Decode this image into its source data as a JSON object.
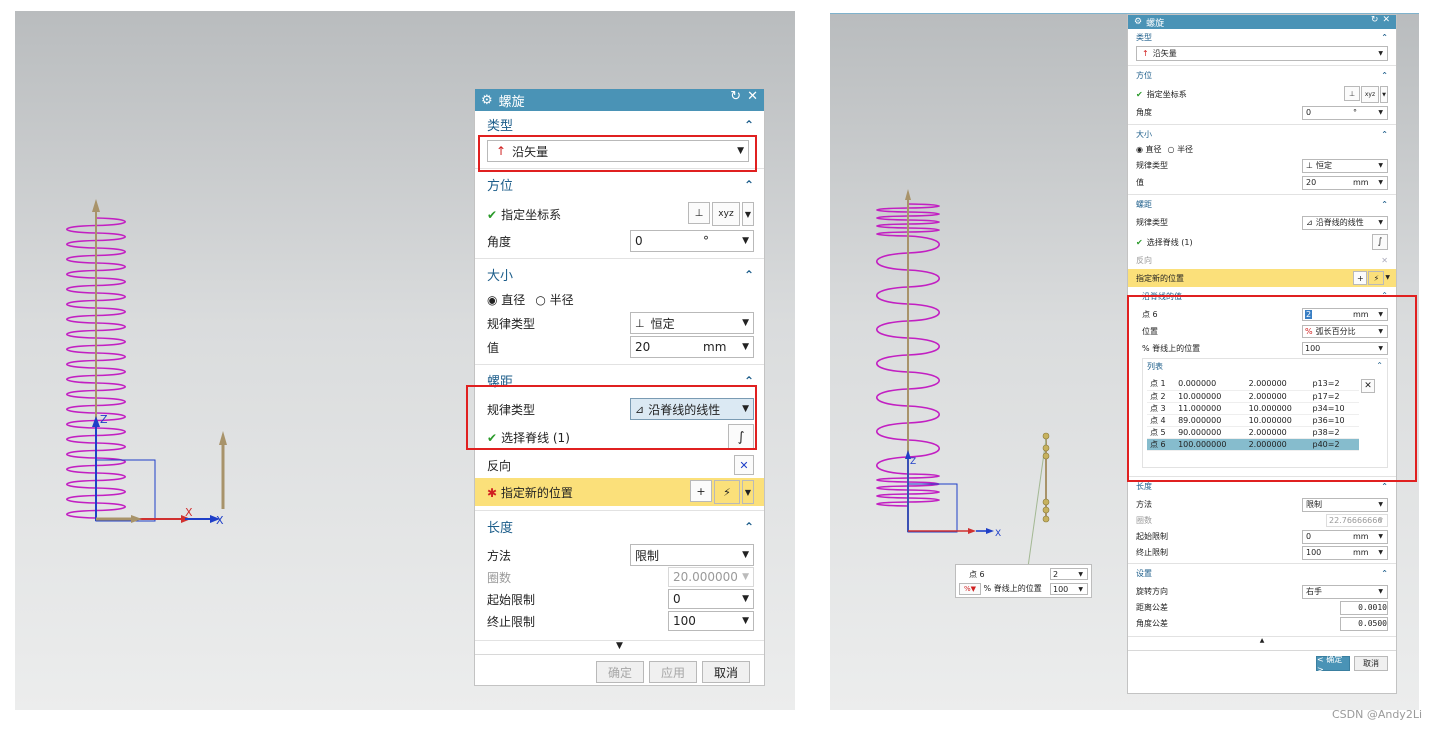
{
  "left": {
    "dialog": {
      "title": "螺旋",
      "type_section": {
        "header": "类型",
        "type_value": "沿矢量"
      },
      "orient_section": {
        "header": "方位",
        "csys_label": "指定坐标系",
        "angle_label": "角度",
        "angle_value": "0",
        "angle_unit": "°"
      },
      "size_section": {
        "header": "大小",
        "radio_diameter": "直径",
        "radio_radius": "半径",
        "law_label": "规律类型",
        "law_value": "恒定",
        "value_label": "值",
        "value": "20",
        "unit": "mm"
      },
      "pitch_section": {
        "header": "螺距",
        "law_label": "规律类型",
        "law_value": "沿脊线的线性",
        "spine_label": "选择脊线 (1)",
        "reverse_label": "反向",
        "newpos_label": "指定新的位置"
      },
      "length_section": {
        "header": "长度",
        "method_label": "方法",
        "method_value": "限制",
        "turns_label": "圈数",
        "turns_value": "20.000000",
        "start_label": "起始限制",
        "start_value": "0",
        "end_label": "终止限制",
        "end_value": "100"
      },
      "buttons": {
        "ok": "确定",
        "apply": "应用",
        "cancel": "取消"
      }
    },
    "axis": {
      "y": "Y",
      "z": "Z",
      "x": "X"
    }
  },
  "right": {
    "dialog": {
      "title": "螺旋",
      "type_section": {
        "header": "类型",
        "type_value": "沿矢量"
      },
      "orient_section": {
        "header": "方位",
        "csys_label": "指定坐标系",
        "angle_label": "角度",
        "angle_value": "0",
        "angle_unit": "°"
      },
      "size_section": {
        "header": "大小",
        "radio_diameter": "直径",
        "radio_radius": "半径",
        "law_label": "规律类型",
        "law_value": "恒定",
        "value_label": "值",
        "value": "20",
        "unit": "mm"
      },
      "pitch_section": {
        "header": "螺距",
        "law_label": "规律类型",
        "law_value": "沿脊线的线性",
        "spine_label": "选择脊线 (1)",
        "reverse_label": "反向",
        "newpos_label": "指定新的位置"
      },
      "spine_values": {
        "header": "沿脊线的值",
        "point_label": "点 6",
        "point_value": "2",
        "point_unit": "mm",
        "position_label": "位置",
        "position_value": "弧长百分比",
        "pct_label": "% 脊线上的位置",
        "pct_value": "100",
        "list_header": "列表",
        "rows": [
          [
            "点 1",
            "0.000000",
            "2.000000",
            "p13=2"
          ],
          [
            "点 2",
            "10.000000",
            "2.000000",
            "p17=2"
          ],
          [
            "点 3",
            "11.000000",
            "10.000000",
            "p34=10"
          ],
          [
            "点 4",
            "89.000000",
            "10.000000",
            "p36=10"
          ],
          [
            "点 5",
            "90.000000",
            "2.000000",
            "p38=2"
          ],
          [
            "点 6",
            "100.000000",
            "2.000000",
            "p40=2"
          ]
        ],
        "selected_row": 5
      },
      "length_section": {
        "header": "长度",
        "method_label": "方法",
        "method_value": "限制",
        "turns_label": "圈数",
        "turns_value": "22.76666666",
        "start_label": "起始限制",
        "start_value": "0",
        "start_unit": "mm",
        "end_label": "终止限制",
        "end_value": "100",
        "end_unit": "mm"
      },
      "settings_section": {
        "header": "设置",
        "rot_label": "旋转方向",
        "rot_value": "右手",
        "dist_label": "距离公差",
        "dist_value": "0.0010",
        "ang_label": "角度公差",
        "ang_value": "0.0500"
      },
      "buttons": {
        "ok": "< 确定 >",
        "cancel": "取消"
      }
    },
    "popup": {
      "point_label": "点 6",
      "point_value": "2",
      "pct_label": "% 脊线上的位置",
      "pct_value": "100"
    }
  },
  "credit": "CSDN @Andy2Li",
  "colors": {
    "accent": "#4a93b6",
    "helix": "#c21fc2",
    "highlight": "#fbe07a",
    "redbox": "#e02020"
  }
}
